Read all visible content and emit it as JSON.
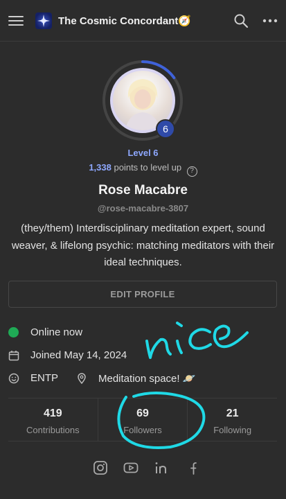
{
  "header": {
    "app_title": "The Cosmic Concordant🧭",
    "icons": [
      "menu-icon",
      "search-icon",
      "more-icon"
    ]
  },
  "profile": {
    "level_badge": "6",
    "level_label": "Level 6",
    "points": "1,338",
    "points_suffix": "points to level up",
    "level_progress": 0.15,
    "name": "Rose Macabre",
    "handle": "@rose-macabre-3807",
    "bio": "(they/them) Interdisciplinary meditation expert, sound weaver, & lifelong psychic: matching meditators with their ideal techniques.",
    "edit_label": "EDIT PROFILE"
  },
  "info": {
    "status": "Online now",
    "joined": "Joined May 14, 2024",
    "mbti": "ENTP",
    "location": "Meditation space! 🪐"
  },
  "stats": [
    {
      "value": "419",
      "label": "Contributions"
    },
    {
      "value": "69",
      "label": "Followers"
    },
    {
      "value": "21",
      "label": "Following"
    }
  ],
  "socials": [
    "instagram-icon",
    "youtube-icon",
    "linkedin-icon",
    "facebook-icon"
  ],
  "annotation": {
    "text": "nice",
    "color": "#1fd9e6"
  },
  "colors": {
    "accent": "#8ea8ff",
    "online": "#1faa55",
    "background": "#2c2c2c"
  }
}
